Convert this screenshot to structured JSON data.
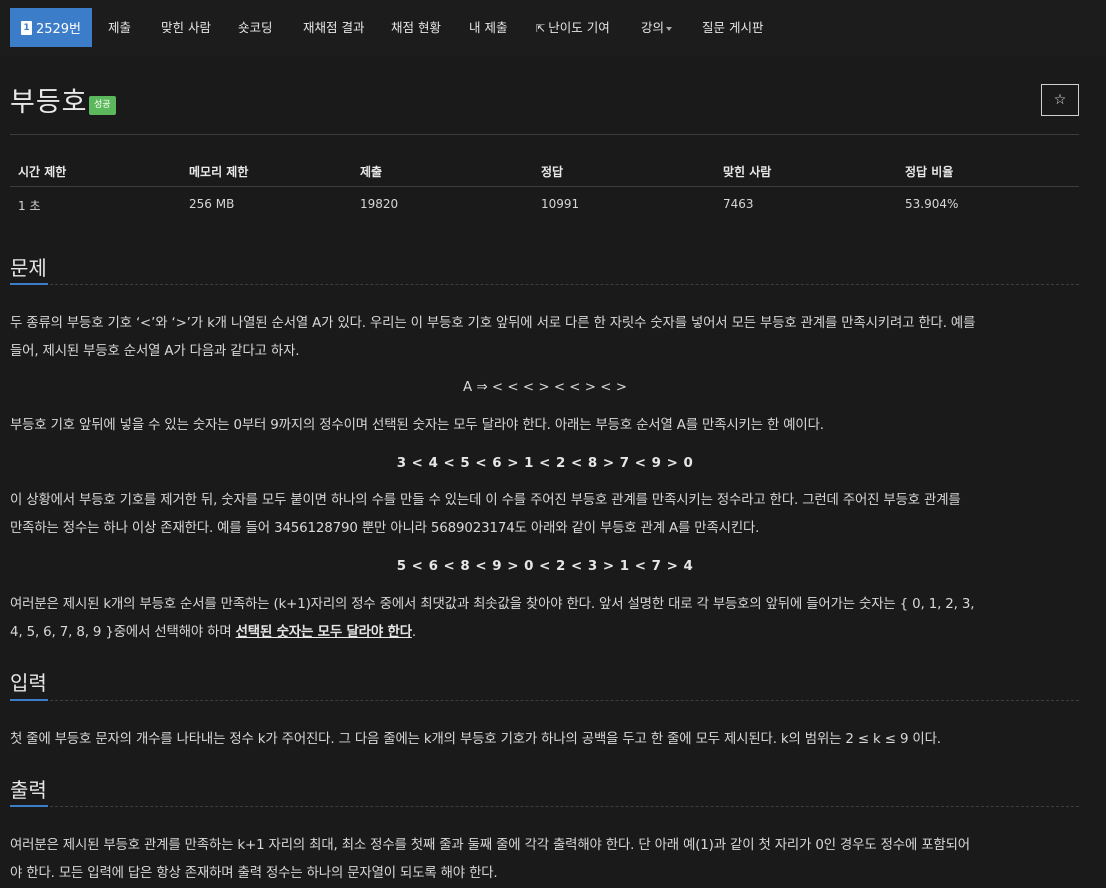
{
  "nav": {
    "problem_label": "2529번",
    "items": [
      "제출",
      "맞힌 사람",
      "숏코딩",
      "재채점 결과",
      "채점 현황",
      "내 제출",
      "난이도 기여",
      "강의",
      "질문 게시판"
    ]
  },
  "header": {
    "title": "부등호",
    "badge": "성공",
    "star": "☆"
  },
  "stats": {
    "headers": [
      "시간 제한",
      "메모리 제한",
      "제출",
      "정답",
      "맞힌 사람",
      "정답 비율"
    ],
    "values": [
      "1 초",
      "256 MB",
      "19820",
      "10991",
      "7463",
      "53.904%"
    ]
  },
  "problem": {
    "title": "문제",
    "p1_line1": "두 종류의 부등호 기호 ‘<’와 ‘>’가 k개 나열된 순서열 A가 있다. 우리는 이 부등호 기호 앞뒤에 서로 다른 한 자릿수 숫자를 넣어서 모든 부등호 관계를 만족시키려고 한다. 예를",
    "p1_line2": "들어, 제시된 부등호 순서열 A가 다음과 같다고 하자.",
    "example_a": "A ⇒ < < < > < < > < >",
    "p2": "부등호 기호 앞뒤에 넣을 수 있는 숫자는 0부터 9까지의 정수이며 선택된 숫자는 모두 달라야 한다. 아래는 부등호 순서열 A를 만족시키는 한 예이다.",
    "example_b": "3 < 4 < 5 < 6 > 1 < 2 < 8 > 7 < 9 > 0",
    "p3_line1": "이 상황에서 부등호 기호를 제거한 뒤, 숫자를 모두 붙이면 하나의 수를 만들 수 있는데 이 수를 주어진 부등호 관계를 만족시키는 정수라고 한다. 그런데 주어진 부등호 관계를",
    "p3_line2": "만족하는 정수는 하나 이상 존재한다. 예를 들어 3456128790 뿐만 아니라 5689023174도 아래와 같이 부등호 관계 A를 만족시킨다.",
    "example_c": "5 < 6 < 8 < 9 > 0 < 2 < 3 > 1 < 7 > 4",
    "p4_line1": "여러분은 제시된 k개의 부등호 순서를 만족하는 (k+1)자리의 정수 중에서 최댓값과 최솟값을 찾아야 한다. 앞서 설명한 대로 각 부등호의 앞뒤에 들어가는 숫자는 { 0, 1, 2, 3,",
    "p4_line2_pre": "4, 5, 6, 7, 8, 9 }중에서 선택해야 하며 ",
    "p4_line2_emph": "선택된 숫자는 모두 달라야 한다",
    "p4_line2_post": "."
  },
  "input": {
    "title": "입력",
    "text": "첫 줄에 부등호 문자의 개수를 나타내는 정수 k가 주어진다. 그 다음 줄에는 k개의 부등호 기호가 하나의 공백을 두고 한 줄에 모두 제시된다. k의 범위는 2 ≤ k ≤ 9 이다."
  },
  "output": {
    "title": "출력",
    "line1": "여러분은 제시된 부등호 관계를 만족하는 k+1 자리의 최대, 최소 정수를 첫째 줄과 둘째 줄에 각각 출력해야 한다. 단 아래 예(1)과 같이 첫 자리가 0인 경우도 정수에 포함되어",
    "line2": "야 한다. 모든 입력에 답은 항상 존재하며 출력 정수는 하나의 문자열이 되도록 해야 한다."
  }
}
